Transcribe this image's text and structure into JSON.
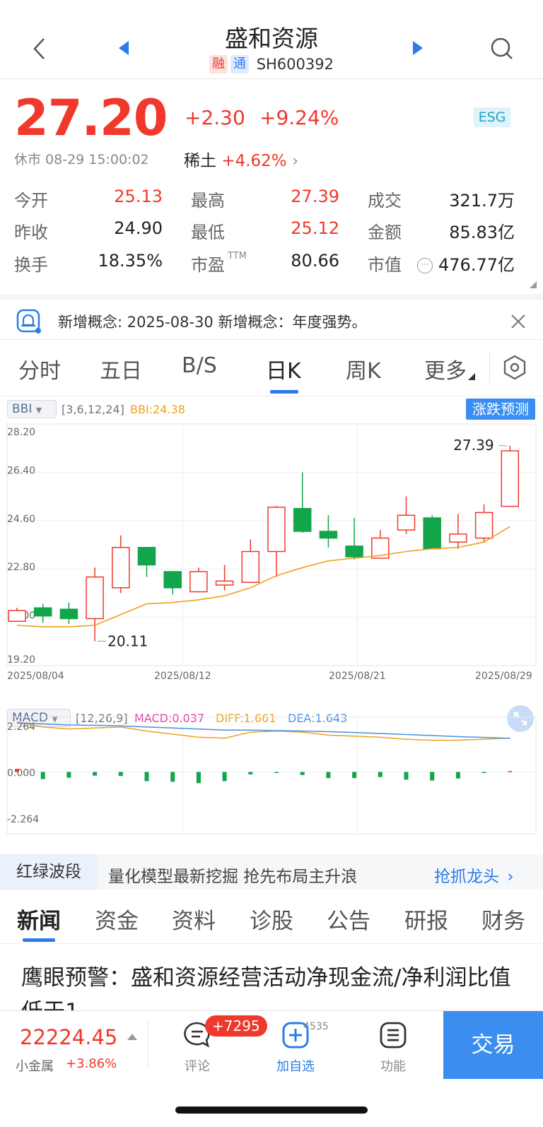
{
  "header": {
    "title": "盛和资源",
    "tag_rong": "融",
    "tag_tong": "通",
    "code": "SH600392",
    "icons": [
      "back-chevron-icon",
      "prev-stock-icon",
      "next-stock-icon",
      "search-icon"
    ]
  },
  "quote": {
    "price": "27.20",
    "change": "+2.30",
    "change_pct": "+9.24%",
    "esg": "ESG",
    "status": "休市 08-29 15:00:02",
    "sector_name": "稀土",
    "sector_pct": "+4.62%"
  },
  "stats": [
    {
      "label": "今开",
      "value": "25.13",
      "color": "#f0382c"
    },
    {
      "label": "最高",
      "value": "27.39",
      "color": "#f0382c"
    },
    {
      "label": "成交",
      "value": "321.7万",
      "color": "#222222"
    },
    {
      "label": "昨收",
      "value": "24.90",
      "color": "#222222"
    },
    {
      "label": "最低",
      "value": "25.12",
      "color": "#f0382c"
    },
    {
      "label": "金额",
      "value": "85.83亿",
      "color": "#222222"
    },
    {
      "label": "换手",
      "value": "18.35%",
      "color": "#222222"
    },
    {
      "label": "市盈",
      "label_sup": "TTM",
      "value": "80.66",
      "color": "#222222"
    },
    {
      "label": "市值",
      "value": "476.77亿",
      "color": "#222222"
    }
  ],
  "notice": {
    "text": "新增概念: 2025-08-30 新增概念：年度强势。"
  },
  "chart_tabs": [
    "分时",
    "五日",
    "B/S",
    "日K",
    "周K",
    "更多"
  ],
  "chart_tabs_active": "日K",
  "indicator_main": {
    "name": "BBI",
    "params": "[3,6,12,24]",
    "value_text": "BBI:24.38",
    "predict_label": "涨跌预测"
  },
  "indicator_sub": {
    "name": "MACD",
    "params": "[12,26,9]",
    "macd_text": "MACD:0.037",
    "diff_text": "DIFF:1.661",
    "dea_text": "DEA:1.643"
  },
  "chart_data": {
    "type": "candlestick",
    "y_ticks": [
      "28.20",
      "26.40",
      "24.60",
      "22.80",
      "21.00",
      "19.20"
    ],
    "ylim": [
      19.2,
      28.2
    ],
    "x_ticks": [
      "2025/08/04",
      "2025/08/12",
      "2025/08/21",
      "2025/08/29"
    ],
    "max_label": "27.39",
    "min_label": "20.11",
    "candles": [
      {
        "o": 20.85,
        "c": 21.25,
        "h": 21.35,
        "l": 20.85
      },
      {
        "o": 21.35,
        "c": 21.05,
        "h": 21.5,
        "l": 20.8
      },
      {
        "o": 21.3,
        "c": 20.95,
        "h": 21.55,
        "l": 20.75
      },
      {
        "o": 20.95,
        "c": 22.5,
        "h": 22.85,
        "l": 20.11
      },
      {
        "o": 22.1,
        "c": 23.6,
        "h": 24.05,
        "l": 21.9
      },
      {
        "o": 23.6,
        "c": 22.95,
        "h": 23.6,
        "l": 22.5
      },
      {
        "o": 22.7,
        "c": 22.1,
        "h": 22.7,
        "l": 21.85
      },
      {
        "o": 21.95,
        "c": 22.7,
        "h": 22.85,
        "l": 21.95
      },
      {
        "o": 22.2,
        "c": 22.35,
        "h": 22.95,
        "l": 22.0
      },
      {
        "o": 22.3,
        "c": 23.45,
        "h": 23.9,
        "l": 22.3
      },
      {
        "o": 23.45,
        "c": 25.1,
        "h": 25.15,
        "l": 22.5
      },
      {
        "o": 25.05,
        "c": 24.2,
        "h": 26.4,
        "l": 24.15
      },
      {
        "o": 24.2,
        "c": 23.95,
        "h": 24.8,
        "l": 23.6
      },
      {
        "o": 23.65,
        "c": 23.25,
        "h": 24.7,
        "l": 23.15
      },
      {
        "o": 23.2,
        "c": 23.95,
        "h": 24.25,
        "l": 23.2
      },
      {
        "o": 24.25,
        "c": 24.8,
        "h": 25.5,
        "l": 24.1
      },
      {
        "o": 24.7,
        "c": 23.55,
        "h": 24.8,
        "l": 23.55
      },
      {
        "o": 23.8,
        "c": 24.1,
        "h": 24.85,
        "l": 23.55
      },
      {
        "o": 23.95,
        "c": 24.9,
        "h": 25.2,
        "l": 23.8
      },
      {
        "o": 25.13,
        "c": 27.2,
        "h": 27.39,
        "l": 25.12
      }
    ],
    "bbi": [
      20.7,
      20.65,
      20.65,
      20.7,
      21.1,
      21.5,
      21.55,
      21.65,
      21.8,
      22.1,
      22.55,
      22.85,
      23.1,
      23.2,
      23.3,
      23.45,
      23.55,
      23.6,
      23.8,
      24.38
    ],
    "macd": {
      "y_ticks": [
        "2.264",
        "0.000",
        "-2.264"
      ],
      "ylim": [
        -2.264,
        2.264
      ],
      "hist": [
        0.15,
        -0.35,
        -0.28,
        -0.18,
        -0.2,
        -0.45,
        -0.48,
        -0.55,
        -0.45,
        -0.12,
        -0.05,
        -0.15,
        -0.3,
        -0.3,
        -0.25,
        -0.38,
        -0.42,
        -0.32,
        -0.05,
        0.037
      ],
      "diff": [
        2.45,
        2.2,
        2.1,
        2.15,
        2.2,
        2.0,
        1.85,
        1.7,
        1.65,
        1.95,
        2.0,
        1.95,
        1.8,
        1.75,
        1.7,
        1.6,
        1.55,
        1.55,
        1.6,
        1.661
      ],
      "dea": [
        2.4,
        2.35,
        2.3,
        2.28,
        2.25,
        2.2,
        2.15,
        2.1,
        2.05,
        2.05,
        2.02,
        2.0,
        1.97,
        1.93,
        1.88,
        1.83,
        1.78,
        1.73,
        1.69,
        1.643
      ]
    },
    "colors": {
      "up": "#f0382c",
      "down": "#12a54b",
      "bbi": "#f0a020",
      "diff": "#f0a020",
      "dea": "#4a90e2",
      "macd": "#e040a0"
    }
  },
  "promo": {
    "tag": "红绿波段",
    "text": "量化模型最新挖掘 抢先布局主升浪",
    "link": "抢抓龙头"
  },
  "news_tabs": [
    "新闻",
    "资金",
    "资料",
    "诊股",
    "公告",
    "研报",
    "财务"
  ],
  "news_tabs_active": "新闻",
  "news_title": "鹰眼预警：盛和资源经营活动净现金流/净利润比值低于1",
  "bottom": {
    "index_value": "22224.45",
    "index_name": "小金属",
    "index_pct": "+3.86%",
    "comment_label": "评论",
    "comment_badge": "+7295",
    "fav_label": "加自选",
    "fav_count": "4535",
    "func_label": "功能",
    "trade_label": "交易"
  }
}
